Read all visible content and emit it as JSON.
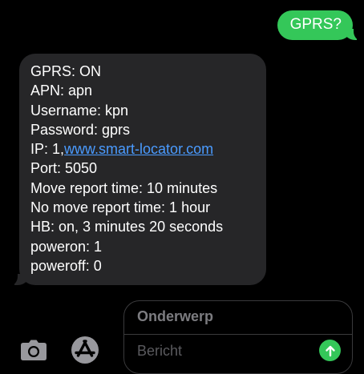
{
  "conversation": {
    "outgoing": {
      "text": "GPRS?"
    },
    "incoming": {
      "lines": [
        "GPRS: ON",
        "APN: apn",
        "Username: kpn",
        "Password: gprs",
        "IP: 1,",
        "Port: 5050",
        "Move report time: 10 minutes",
        "No move report time: 1 hour",
        "HB: on, 3 minutes 20 seconds",
        "poweron: 1",
        "poweroff: 0"
      ],
      "link_text": "www.smart-locator.com"
    }
  },
  "composer": {
    "subject_placeholder": "Onderwerp",
    "message_placeholder": "Bericht"
  },
  "icons": {
    "camera": "camera-icon",
    "app_store": "app-store-icon",
    "send": "arrow-up-icon"
  },
  "colors": {
    "background": "#000000",
    "outgoing_bubble": "#34c759",
    "incoming_bubble": "#262628",
    "link": "#4a9bff",
    "send_button": "#34c759"
  }
}
